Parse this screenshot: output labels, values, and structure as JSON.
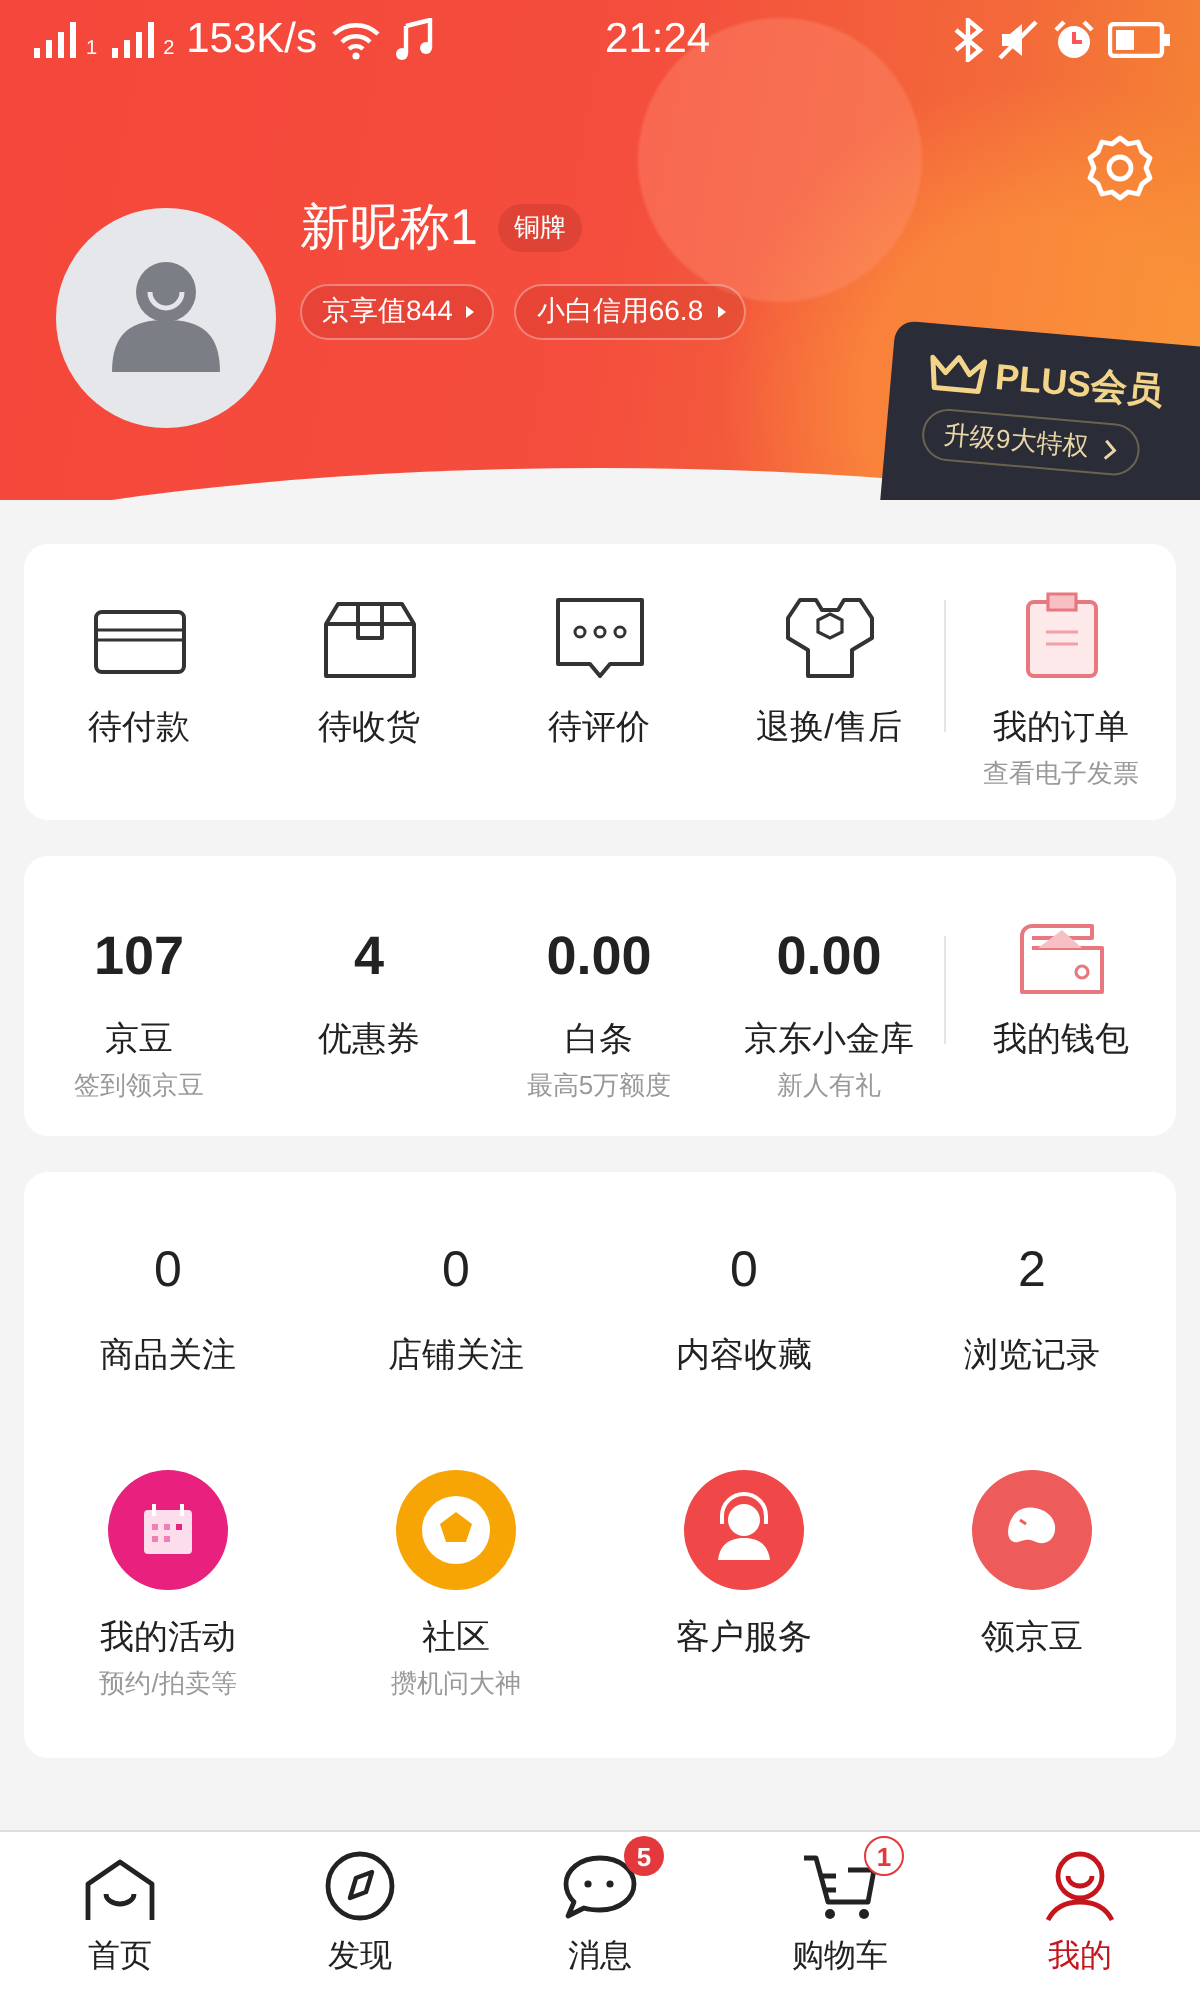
{
  "status_bar": {
    "sims": [
      {
        "label": "1"
      },
      {
        "label": "2"
      }
    ],
    "net_speed": "153K/s",
    "time": "21:24"
  },
  "profile": {
    "name": "新昵称1",
    "level_badge": "铜牌",
    "chips": [
      {
        "label": "京享值844"
      },
      {
        "label": "小白信用66.8"
      }
    ],
    "plus": {
      "title": "PLUS会员",
      "button": "升级9大特权"
    }
  },
  "orders": {
    "items": [
      {
        "label": "待付款",
        "kind": "status"
      },
      {
        "label": "待收货",
        "kind": "status"
      },
      {
        "label": "待评价",
        "kind": "status"
      },
      {
        "label": "退换/售后",
        "kind": "status"
      },
      {
        "label": "我的订单",
        "sub": "查看电子发票",
        "kind": "summary"
      }
    ]
  },
  "wallet": {
    "items": [
      {
        "value": "107",
        "label": "京豆",
        "sub": "签到领京豆",
        "kind": "stat"
      },
      {
        "value": "4",
        "label": "优惠券",
        "kind": "stat"
      },
      {
        "value": "0.00",
        "label": "白条",
        "sub": "最高5万额度",
        "kind": "stat"
      },
      {
        "value": "0.00",
        "label": "京东小金库",
        "sub": "新人有礼",
        "kind": "stat"
      },
      {
        "label": "我的钱包",
        "kind": "summary"
      }
    ]
  },
  "favorites": {
    "counts": [
      {
        "value": "0",
        "label": "商品关注"
      },
      {
        "value": "0",
        "label": "店铺关注"
      },
      {
        "value": "0",
        "label": "内容收藏"
      },
      {
        "value": "2",
        "label": "浏览记录"
      }
    ],
    "services": [
      {
        "label": "我的活动",
        "sub": "预约/拍卖等",
        "color": "#e8207e"
      },
      {
        "label": "社区",
        "sub": "攒机问大神",
        "color": "#f6a505"
      },
      {
        "label": "客户服务",
        "color": "#f04848"
      },
      {
        "label": "领京豆",
        "color": "#ee5b5b"
      }
    ]
  },
  "tab_bar": {
    "tabs": [
      {
        "label": "首页",
        "selected": false
      },
      {
        "label": "发现",
        "selected": false
      },
      {
        "label": "消息",
        "selected": false,
        "badge": {
          "text": "5",
          "kind": "filled"
        }
      },
      {
        "label": "购物车",
        "selected": false,
        "badge": {
          "text": "1",
          "kind": "outline"
        }
      },
      {
        "label": "我的",
        "selected": true
      }
    ]
  }
}
